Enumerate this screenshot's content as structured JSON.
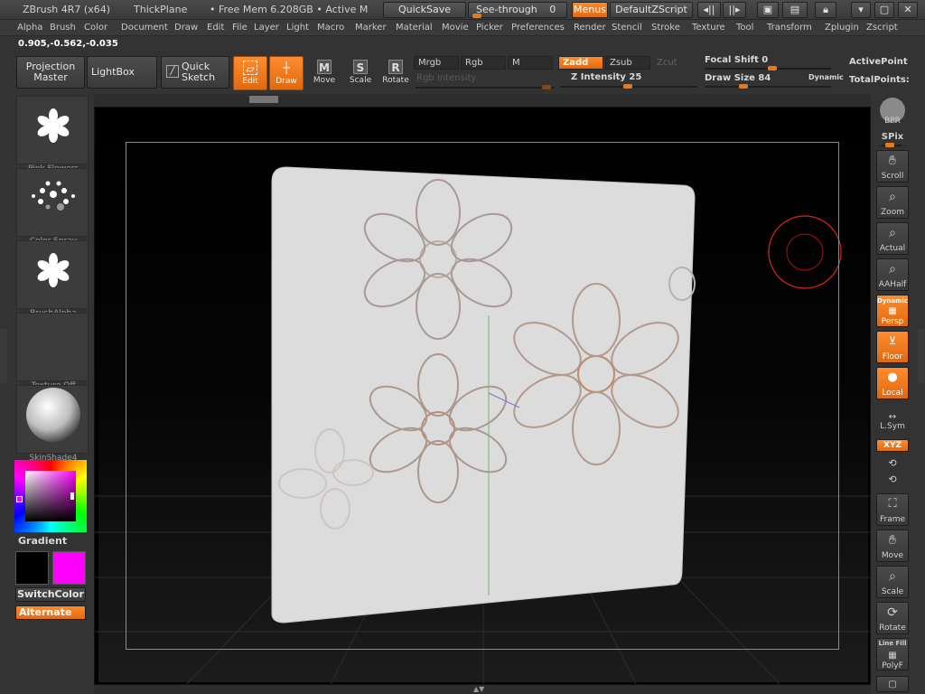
{
  "titlebar": {
    "app": "ZBrush 4R7 (x64)",
    "tool": "ThickPlane",
    "mem": "• Free Mem 6.208GB • Active M",
    "quicksave": "QuickSave",
    "seethrough": "See-through",
    "seethrough_value": "0",
    "menus": "Menus",
    "script": "DefaultZScript"
  },
  "menubar": [
    "Alpha",
    "Brush",
    "Color",
    "Document",
    "Draw",
    "Edit",
    "File",
    "Layer",
    "Light",
    "Macro",
    "Marker",
    "Material",
    "Movie",
    "Picker",
    "Preferences",
    "Render",
    "Stencil",
    "Stroke",
    "Texture",
    "Tool",
    "Transform",
    "Zplugin",
    "Zscript"
  ],
  "coords": "0.905,-0.562,-0.035",
  "shelf": {
    "projection": "Projection",
    "master": "Master",
    "lightbox": "LightBox",
    "quick": "Quick",
    "sketch": "Sketch",
    "edit": "Edit",
    "draw": "Draw",
    "move": "Move",
    "scale": "Scale",
    "rotate": "Rotate",
    "mrgb": "Mrgb",
    "rgb": "Rgb",
    "m": "M",
    "zadd": "Zadd",
    "zsub": "Zsub",
    "zcut": "Zcut",
    "rgb_intensity": "Rgb Intensity",
    "z_intensity": "Z Intensity 25",
    "focal_shift": "Focal Shift 0",
    "draw_size": "Draw Size 84",
    "dynamic": "Dynamic",
    "activepoints": "ActivePoint",
    "totalpoints": "TotalPoints:"
  },
  "left": {
    "tiles": [
      "Pink Flowers",
      "Color Spray",
      "BrushAlpha",
      "Texture Off",
      "SkinShade4"
    ],
    "gradient": "Gradient",
    "switchcolor": "SwitchColor",
    "alternate": "Alternate"
  },
  "right": {
    "bpr": "BPR",
    "spix": "SPix",
    "scroll": "Scroll",
    "zoom": "Zoom",
    "actual": "Actual",
    "aahalf": "AAHalf",
    "dynamic": "Dynamic",
    "persp": "Persp",
    "floor": "Floor",
    "local": "Local",
    "lsym": "L.Sym",
    "xyz": "XYZ",
    "frame": "Frame",
    "move": "Move",
    "scale": "Scale",
    "rotate": "Rotate",
    "linefill": "Line Fill",
    "polyf": "PolyF"
  },
  "colors": {
    "accent": "#e87a1c",
    "main_color": "#000000",
    "secondary_color": "#ff00ff"
  }
}
